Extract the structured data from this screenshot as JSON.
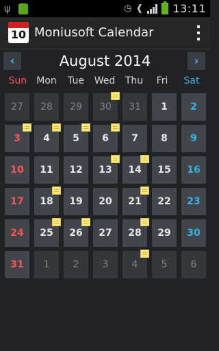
{
  "statusbar": {
    "time": "13:11",
    "icons": [
      "usb-icon",
      "android-notification-icon",
      "alarm-icon",
      "wifi-icon",
      "signal-icon",
      "battery-icon"
    ]
  },
  "appbar": {
    "icon_number": "10",
    "title": "Moniusoft Calendar"
  },
  "nav": {
    "prev_label": "‹",
    "next_label": "›",
    "month_title": "August 2014"
  },
  "weekdays": [
    "Sun",
    "Mon",
    "Tue",
    "Wed",
    "Thu",
    "Fri",
    "Sat"
  ],
  "weeks": [
    [
      {
        "day": "27",
        "cur": false,
        "note": false
      },
      {
        "day": "28",
        "cur": false,
        "note": false
      },
      {
        "day": "29",
        "cur": false,
        "note": false
      },
      {
        "day": "30",
        "cur": false,
        "note": true
      },
      {
        "day": "31",
        "cur": false,
        "note": false
      },
      {
        "day": "1",
        "cur": true,
        "note": false
      },
      {
        "day": "2",
        "cur": true,
        "note": false
      }
    ],
    [
      {
        "day": "3",
        "cur": true,
        "note": true
      },
      {
        "day": "4",
        "cur": true,
        "note": true
      },
      {
        "day": "5",
        "cur": true,
        "note": true
      },
      {
        "day": "6",
        "cur": true,
        "note": true
      },
      {
        "day": "7",
        "cur": true,
        "note": false
      },
      {
        "day": "8",
        "cur": true,
        "note": false
      },
      {
        "day": "9",
        "cur": true,
        "note": false
      }
    ],
    [
      {
        "day": "10",
        "cur": true,
        "note": false
      },
      {
        "day": "11",
        "cur": true,
        "note": false
      },
      {
        "day": "12",
        "cur": true,
        "note": false
      },
      {
        "day": "13",
        "cur": true,
        "note": true
      },
      {
        "day": "14",
        "cur": true,
        "note": true
      },
      {
        "day": "15",
        "cur": true,
        "note": false
      },
      {
        "day": "16",
        "cur": true,
        "note": false
      }
    ],
    [
      {
        "day": "17",
        "cur": true,
        "note": false
      },
      {
        "day": "18",
        "cur": true,
        "note": true
      },
      {
        "day": "19",
        "cur": true,
        "note": false
      },
      {
        "day": "20",
        "cur": true,
        "note": false
      },
      {
        "day": "21",
        "cur": true,
        "note": true
      },
      {
        "day": "22",
        "cur": true,
        "note": false
      },
      {
        "day": "23",
        "cur": true,
        "note": false
      }
    ],
    [
      {
        "day": "24",
        "cur": true,
        "note": false
      },
      {
        "day": "25",
        "cur": true,
        "note": true
      },
      {
        "day": "26",
        "cur": true,
        "note": true
      },
      {
        "day": "27",
        "cur": true,
        "note": false
      },
      {
        "day": "28",
        "cur": true,
        "note": true
      },
      {
        "day": "29",
        "cur": true,
        "note": false
      },
      {
        "day": "30",
        "cur": true,
        "note": false
      }
    ],
    [
      {
        "day": "31",
        "cur": true,
        "note": false
      },
      {
        "day": "1",
        "cur": false,
        "note": false
      },
      {
        "day": "2",
        "cur": false,
        "note": false
      },
      {
        "day": "3",
        "cur": false,
        "note": false
      },
      {
        "day": "4",
        "cur": false,
        "note": true
      },
      {
        "day": "5",
        "cur": false,
        "note": false
      },
      {
        "day": "6",
        "cur": false,
        "note": false
      }
    ]
  ],
  "colors": {
    "sunday": "#ff5252",
    "saturday": "#33b5e5",
    "accent": "#4cc0ff",
    "note": "#ffe97a"
  }
}
